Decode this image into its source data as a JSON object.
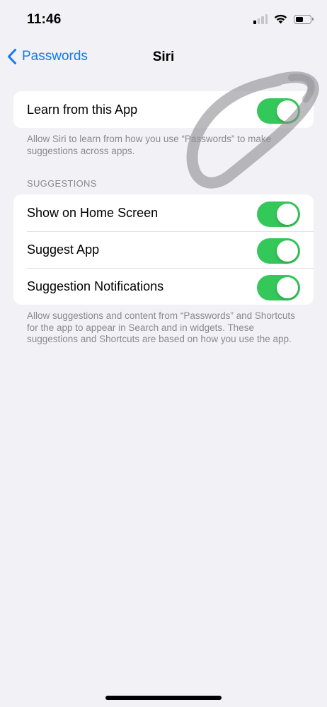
{
  "status_bar": {
    "time": "11:46",
    "signal_bars_active": 1,
    "signal_bars_total": 4,
    "battery_level": 0.5,
    "icons": [
      "cellular-signal-icon",
      "wifi-icon",
      "battery-icon"
    ]
  },
  "nav": {
    "back_label": "Passwords",
    "back_icon": "chevron-left-icon",
    "title": "Siri"
  },
  "learn_group": {
    "items": [
      {
        "label": "Learn from this App",
        "enabled": true
      }
    ],
    "footer": "Allow Siri to learn from how you use “Passwords” to make suggestions across apps."
  },
  "suggestions_group": {
    "header": "SUGGESTIONS",
    "items": [
      {
        "label": "Show on Home Screen",
        "enabled": true
      },
      {
        "label": "Suggest App",
        "enabled": true
      },
      {
        "label": "Suggestion Notifications",
        "enabled": true
      }
    ],
    "footer": "Allow suggestions and content from “Passwords” and Shortcuts for the app to appear in Search and in widgets. These suggestions and Shortcuts are based on how you use the app."
  },
  "colors": {
    "accent": "#1479f2",
    "toggle_on": "#34c759",
    "background": "#f1f1f6",
    "secondary_text": "#8a8a8e",
    "annotation": "#8e8e93"
  }
}
